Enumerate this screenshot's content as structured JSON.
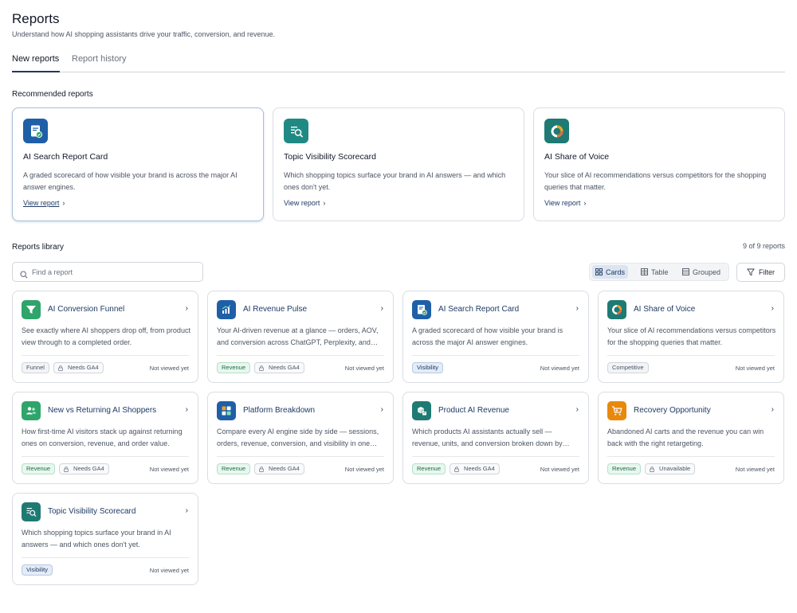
{
  "header": {
    "title": "Reports",
    "subtitle": "Understand how AI shopping assistants drive your traffic, conversion, and revenue."
  },
  "tabs": [
    {
      "label": "New reports",
      "active": true
    },
    {
      "label": "Report history",
      "active": false
    }
  ],
  "recommended": {
    "title": "Recommended reports",
    "cards": [
      {
        "title": "AI Search Report Card",
        "description": "A graded scorecard of how visible your brand is across the major AI answer engines.",
        "link": "View report",
        "icon": "report-card-icon"
      },
      {
        "title": "Topic Visibility Scorecard",
        "description": "Which shopping topics surface your brand in AI answers — and which ones don't yet.",
        "link": "View report",
        "icon": "topic-search-icon"
      },
      {
        "title": "AI Share of Voice",
        "description": "Your slice of AI recommendations versus competitors for the shopping queries that matter.",
        "link": "View report",
        "icon": "donut-chart-icon"
      }
    ]
  },
  "library": {
    "title": "Reports library",
    "count": "9 of 9 reports",
    "search_placeholder": "Find a report",
    "views": [
      {
        "label": "Cards",
        "active": true
      },
      {
        "label": "Table",
        "active": false
      },
      {
        "label": "Grouped",
        "active": false
      }
    ],
    "filter_label": "Filter",
    "cards": [
      {
        "title": "AI Conversion Funnel",
        "description": "See exactly where AI shoppers drop off, from product view through to a completed order.",
        "tags": [
          {
            "label": "Funnel",
            "kind": "funnel"
          },
          {
            "label": "Needs GA4",
            "kind": "neutral",
            "lock": true
          }
        ],
        "status": "Not viewed yet",
        "icon": "funnel-icon",
        "color": "#2fa56b"
      },
      {
        "title": "AI Revenue Pulse",
        "description": "Your AI-driven revenue at a glance — orders, AOV, and conversion across ChatGPT, Perplexity, and more.",
        "tags": [
          {
            "label": "Revenue",
            "kind": "revenue"
          },
          {
            "label": "Needs GA4",
            "kind": "neutral",
            "lock": true
          }
        ],
        "status": "Not viewed yet",
        "icon": "bar-chart-icon",
        "color": "#1f5fa8"
      },
      {
        "title": "AI Search Report Card",
        "description": "A graded scorecard of how visible your brand is across the major AI answer engines.",
        "tags": [
          {
            "label": "Visibility",
            "kind": "visibility"
          }
        ],
        "status": "Not viewed yet",
        "icon": "report-card-icon",
        "color": "#1f5fa8"
      },
      {
        "title": "AI Share of Voice",
        "description": "Your slice of AI recommendations versus competitors for the shopping queries that matter.",
        "tags": [
          {
            "label": "Competitive",
            "kind": "competitive"
          }
        ],
        "status": "Not viewed yet",
        "icon": "donut-chart-icon",
        "color": "#1f7a73"
      },
      {
        "title": "New vs Returning AI Shoppers",
        "description": "How first-time AI visitors stack up against returning ones on conversion, revenue, and order value.",
        "tags": [
          {
            "label": "Revenue",
            "kind": "revenue"
          },
          {
            "label": "Needs GA4",
            "kind": "neutral",
            "lock": true
          }
        ],
        "status": "Not viewed yet",
        "icon": "users-icon",
        "color": "#2fa56b"
      },
      {
        "title": "Platform Breakdown",
        "description": "Compare every AI engine side by side — sessions, orders, revenue, conversion, and visibility in one view.",
        "tags": [
          {
            "label": "Revenue",
            "kind": "revenue"
          },
          {
            "label": "Needs GA4",
            "kind": "neutral",
            "lock": true
          }
        ],
        "status": "Not viewed yet",
        "icon": "grid-icon",
        "color": "#1f5fa8"
      },
      {
        "title": "Product AI Revenue",
        "description": "Which products AI assistants actually sell — revenue, units, and conversion broken down by product.",
        "tags": [
          {
            "label": "Revenue",
            "kind": "revenue"
          },
          {
            "label": "Needs GA4",
            "kind": "neutral",
            "lock": true
          }
        ],
        "status": "Not viewed yet",
        "icon": "boxes-icon",
        "color": "#1f7a73"
      },
      {
        "title": "Recovery Opportunity",
        "description": "Abandoned AI carts and the revenue you can win back with the right retargeting.",
        "tags": [
          {
            "label": "Revenue",
            "kind": "revenue"
          },
          {
            "label": "Unavailable",
            "kind": "neutral",
            "lock": true
          }
        ],
        "status": "Not viewed yet",
        "icon": "cart-icon",
        "color": "#e8890c"
      },
      {
        "title": "Topic Visibility Scorecard",
        "description": "Which shopping topics surface your brand in AI answers — and which ones don't yet.",
        "tags": [
          {
            "label": "Visibility",
            "kind": "visibility"
          }
        ],
        "status": "Not viewed yet",
        "icon": "topic-search-icon",
        "color": "#1f7a73"
      }
    ]
  }
}
